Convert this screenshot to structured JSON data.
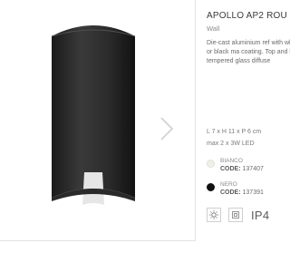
{
  "product": {
    "title": "APOLLO AP2 ROU",
    "category": "Wall",
    "description": "Die-cast aluminium ref with white or black ma coating. Top and botto tempered glass diffuse",
    "dimensions": "L 7 x H 11 x P 6 cm",
    "power": "max 2 x 3W LED"
  },
  "finishes": [
    {
      "name": "BIANCO",
      "code_label": "CODE:",
      "code": "137407",
      "color": "#f1efe9"
    },
    {
      "name": "NERO",
      "code_label": "CODE:",
      "code": "137391",
      "color": "#111111"
    }
  ],
  "badges": {
    "ip": "IP4"
  },
  "icons": {
    "next": "chevron-right-icon",
    "badge1": "led-lamp-icon",
    "badge2": "class-2-icon"
  }
}
